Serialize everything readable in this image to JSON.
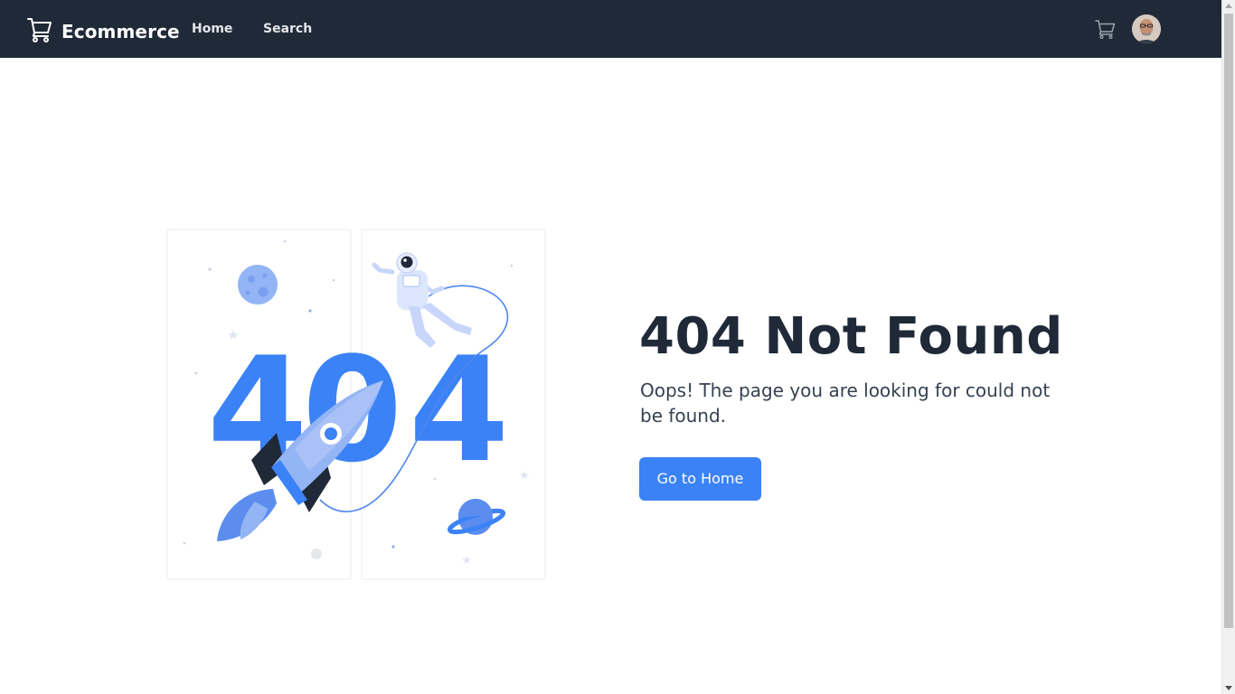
{
  "navbar": {
    "brand": "Ecommerce",
    "brand_icon": "shopping-cart-icon",
    "links": [
      {
        "label": "Home"
      },
      {
        "label": "Search"
      }
    ],
    "cart_icon": "shopping-cart-icon",
    "avatar_icon": "user-avatar"
  },
  "main": {
    "illustration": {
      "big_text": "404",
      "icon": "rocket-astronaut-illustration"
    },
    "title": "404 Not Found",
    "message": "Oops! The page you are looking for could not be found.",
    "button_label": "Go to Home"
  },
  "colors": {
    "navbar_bg": "#1f2937",
    "accent": "#3b82f6",
    "title_text": "#1f2937",
    "body_text": "#374151"
  }
}
